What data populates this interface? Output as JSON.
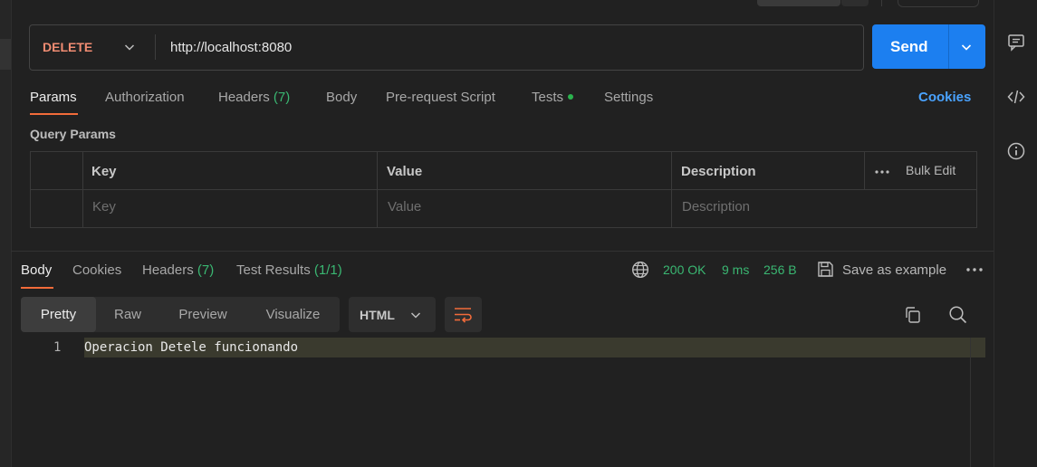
{
  "colors": {
    "accent_orange": "#f26b3a",
    "method": "#f08c72",
    "send_blue": "#1c7ff0",
    "success_green": "#3ab772",
    "link_blue": "#4aa3ff"
  },
  "request": {
    "method": "DELETE",
    "url": "http://localhost:8080",
    "send_label": "Send"
  },
  "request_tabs": {
    "params": "Params",
    "authorization": "Authorization",
    "headers": "Headers",
    "headers_count": "(7)",
    "body": "Body",
    "prerequest": "Pre-request Script",
    "tests": "Tests",
    "settings": "Settings",
    "cookies": "Cookies"
  },
  "query_params": {
    "title": "Query Params",
    "columns": {
      "key": "Key",
      "value": "Value",
      "description": "Description"
    },
    "bulk_edit": "Bulk Edit",
    "placeholders": {
      "key": "Key",
      "value": "Value",
      "description": "Description"
    }
  },
  "response_tabs": {
    "body": "Body",
    "cookies": "Cookies",
    "headers": "Headers",
    "headers_count": "(7)",
    "test_results": "Test Results",
    "test_results_count": "(1/1)"
  },
  "response_status": {
    "status": "200 OK",
    "time": "9 ms",
    "size": "256 B",
    "save_example": "Save as example"
  },
  "viewer": {
    "modes": [
      "Pretty",
      "Raw",
      "Preview",
      "Visualize"
    ],
    "active_mode": "Pretty",
    "format": "HTML"
  },
  "response_body": {
    "line_number": "1",
    "line_text": "Operacion Detele funcionando"
  },
  "icons": {
    "rail": [
      "comment-icon",
      "code-icon",
      "info-icon"
    ],
    "status": "globe-icon",
    "save": "save-icon",
    "copy": "copy-icon",
    "search": "search-icon",
    "wrap": "wrap-lines-icon"
  }
}
